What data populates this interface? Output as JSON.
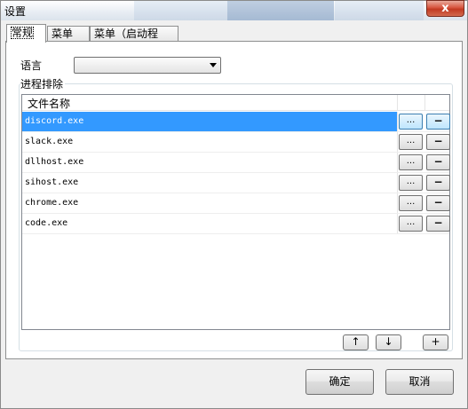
{
  "window": {
    "title": "设置",
    "close_glyph": "x"
  },
  "tabs": [
    {
      "label": "常规",
      "active": true
    },
    {
      "label": "菜单",
      "active": false
    },
    {
      "label": "菜单（启动程序）",
      "active": false
    }
  ],
  "general": {
    "language_label": "语言",
    "language_value": "",
    "exclusion_group_label": "进程排除",
    "column_header": "文件名称",
    "processes": [
      {
        "name": "discord.exe",
        "selected": true
      },
      {
        "name": "slack.exe",
        "selected": false
      },
      {
        "name": "dllhost.exe",
        "selected": false
      },
      {
        "name": "sihost.exe",
        "selected": false
      },
      {
        "name": "chrome.exe",
        "selected": false
      },
      {
        "name": "code.exe",
        "selected": false
      }
    ],
    "browse_label": "...",
    "remove_label": "−",
    "move_up_glyph": "↑",
    "move_down_glyph": "↓",
    "add_label": "+"
  },
  "footer": {
    "ok_label": "确定",
    "cancel_label": "取消"
  },
  "colors": {
    "selection": "#3399ff",
    "close_button": "#c9452d"
  }
}
